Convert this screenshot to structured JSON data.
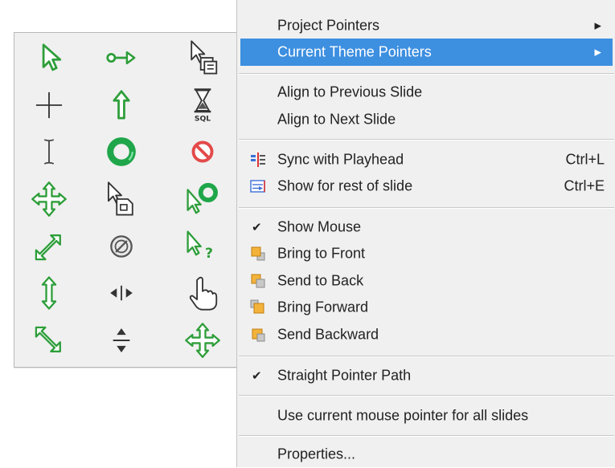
{
  "palette": {
    "icons": [
      "arrow-pointer-icon",
      "link-select-icon",
      "copy-pointer-icon",
      "crosshair-icon",
      "up-arrow-icon",
      "hourglass-sql-icon",
      "text-ibeam-icon",
      "busy-ring-icon",
      "unavailable-icon",
      "move-icon",
      "hand-doc-icon",
      "working-in-background-icon",
      "diagonal-resize-icon",
      "no-entry-icon",
      "help-pointer-icon",
      "vertical-resize-icon",
      "horizontal-split-icon",
      "hand-pointer-icon",
      "diagonal-resize-alt-icon",
      "vertical-split-icon",
      "move-alt-icon"
    ],
    "hourglass_text": "SQL"
  },
  "menu": {
    "project_pointers": "Project Pointers",
    "current_theme_pointers": "Current Theme Pointers",
    "align_previous": "Align to Previous Slide",
    "align_next": "Align to Next Slide",
    "sync_playhead": "Sync with Playhead",
    "sync_playhead_shortcut": "Ctrl+L",
    "show_rest": "Show for rest of slide",
    "show_rest_shortcut": "Ctrl+E",
    "show_mouse": "Show Mouse",
    "bring_front": "Bring to Front",
    "send_back": "Send to Back",
    "bring_forward": "Bring Forward",
    "send_backward": "Send Backward",
    "straight_path": "Straight Pointer Path",
    "use_current": "Use current mouse pointer for all slides",
    "properties": "Properties..."
  },
  "colors": {
    "highlight": "#3d8fe0",
    "pointer_green": "#2e9e3a"
  }
}
